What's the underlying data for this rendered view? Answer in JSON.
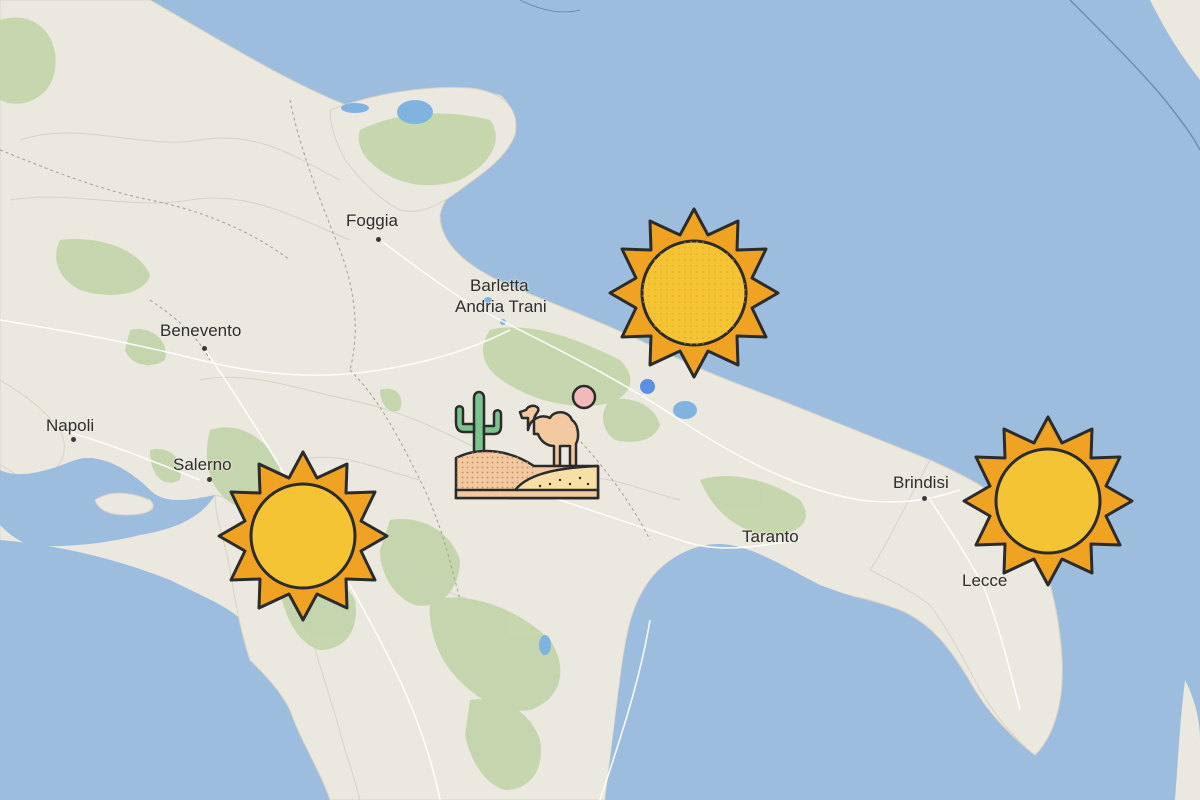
{
  "map": {
    "colors": {
      "sea": "#9dbdde",
      "land": "#ebe8df",
      "forest": "#bfd3a6",
      "lake": "#7fb3e0",
      "sun_fill": "#f5c435",
      "sun_ray": "#f0a222",
      "outline": "#2b2b2b"
    },
    "cities": [
      {
        "id": "foggia",
        "label": "Foggia"
      },
      {
        "id": "barletta",
        "label": "Barletta"
      },
      {
        "id": "andria-trani",
        "label": "Andria Trani"
      },
      {
        "id": "benevento",
        "label": "Benevento"
      },
      {
        "id": "napoli",
        "label": "Napoli"
      },
      {
        "id": "salerno",
        "label": "Salerno"
      },
      {
        "id": "brindisi",
        "label": "Brindisi"
      },
      {
        "id": "taranto",
        "label": "Taranto"
      },
      {
        "id": "lecce",
        "label": "Lecce"
      }
    ],
    "icons": [
      {
        "id": "sun-1",
        "icon": "sun-icon"
      },
      {
        "id": "sun-2",
        "icon": "sun-icon"
      },
      {
        "id": "sun-3",
        "icon": "sun-icon"
      },
      {
        "id": "desert",
        "icon": "desert-camel-cactus-icon"
      }
    ]
  }
}
